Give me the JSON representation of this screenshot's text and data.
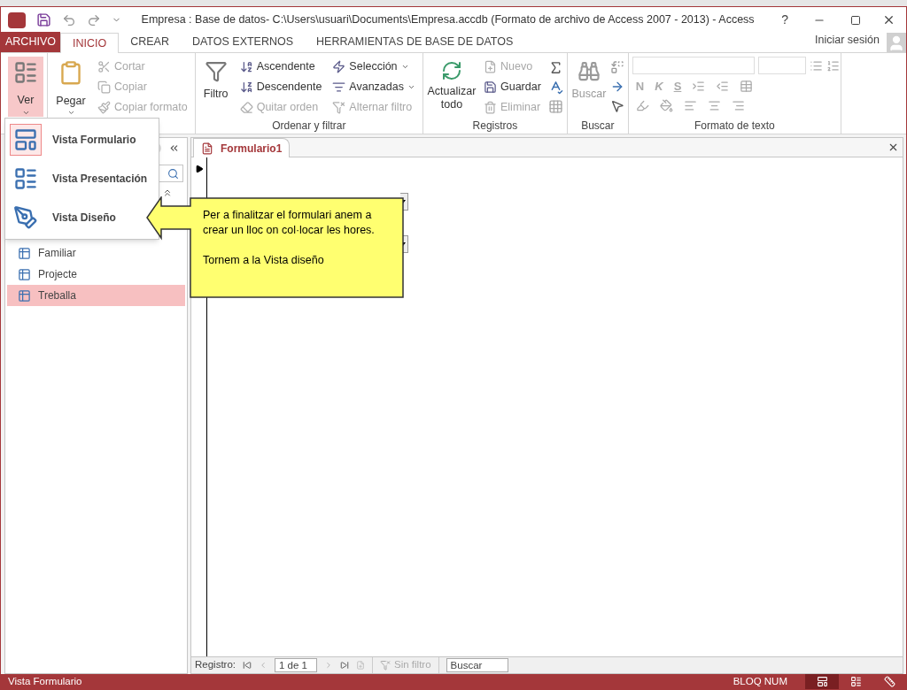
{
  "window": {
    "title": "Empresa : Base de datos- C:\\Users\\usuari\\Documents\\Empresa.accdb (Formato de archivo de Access 2007 - 2013) - Access",
    "help": "?"
  },
  "tabs": [
    {
      "label": "ARCHIVO",
      "kind": "file",
      "selected": false
    },
    {
      "label": "INICIO",
      "kind": "tab",
      "selected": true
    },
    {
      "label": "CREAR",
      "kind": "tab",
      "selected": false
    },
    {
      "label": "DATOS EXTERNOS",
      "kind": "tab",
      "selected": false
    },
    {
      "label": "HERRAMIENTAS DE BASE DE DATOS",
      "kind": "tab",
      "selected": false
    }
  ],
  "account": {
    "label": "Iniciar sesión"
  },
  "ribbon": {
    "views": {
      "label": "Ver",
      "active": true
    },
    "clipboard": {
      "paste": "Pegar",
      "items": [
        {
          "label": "Cortar",
          "disabled": true
        },
        {
          "label": "Copiar",
          "disabled": true
        },
        {
          "label": "Copiar formato",
          "disabled": true
        }
      ]
    },
    "sort_filter": {
      "title": "Ordenar y filtrar",
      "filter": "Filtro",
      "sort": [
        {
          "label": "Ascendente",
          "disabled": false
        },
        {
          "label": "Descendente",
          "disabled": false
        },
        {
          "label": "Quitar orden",
          "disabled": true
        }
      ],
      "filters": [
        {
          "label": "Selección",
          "dropdown": true,
          "disabled": false
        },
        {
          "label": "Avanzadas",
          "dropdown": true,
          "disabled": false
        },
        {
          "label": "Alternar filtro",
          "dropdown": false,
          "disabled": true
        }
      ]
    },
    "records": {
      "title": "Registros",
      "refresh": "Actualizar todo",
      "items": [
        {
          "label": "Nuevo",
          "disabled": true
        },
        {
          "label": "Guardar",
          "disabled": false
        },
        {
          "label": "Eliminar",
          "disabled": true
        }
      ]
    },
    "find": {
      "title": "Buscar",
      "button": "Buscar"
    },
    "text_format": {
      "title": "Formato de texto",
      "styles": [
        "N",
        "K",
        "S"
      ]
    }
  },
  "view_menu": {
    "items": [
      {
        "label": "Vista Formulario",
        "selected": true
      },
      {
        "label": "Vista Presentación",
        "selected": false
      },
      {
        "label": "Vista Diseño",
        "selected": false
      }
    ]
  },
  "nav_pane": {
    "items": [
      {
        "label": "Familiar",
        "selected": false
      },
      {
        "label": "Projecte",
        "selected": false
      },
      {
        "label": "Treballa",
        "selected": true
      }
    ]
  },
  "document": {
    "tab": "Formulario1",
    "callout": [
      "Per a finalitzar el formulari anem a crear un lloc on col·locar les hores.",
      "Tornem a la Vista diseño"
    ]
  },
  "record_nav": {
    "label": "Registro:",
    "position": "1 de 1",
    "filter": "Sin filtro",
    "search": "Buscar"
  },
  "status_bar": {
    "view": "Vista Formulario",
    "indicator": "BLOQ NUM",
    "views": [
      {
        "selected": true
      },
      {
        "selected": false
      },
      {
        "selected": false
      }
    ]
  }
}
